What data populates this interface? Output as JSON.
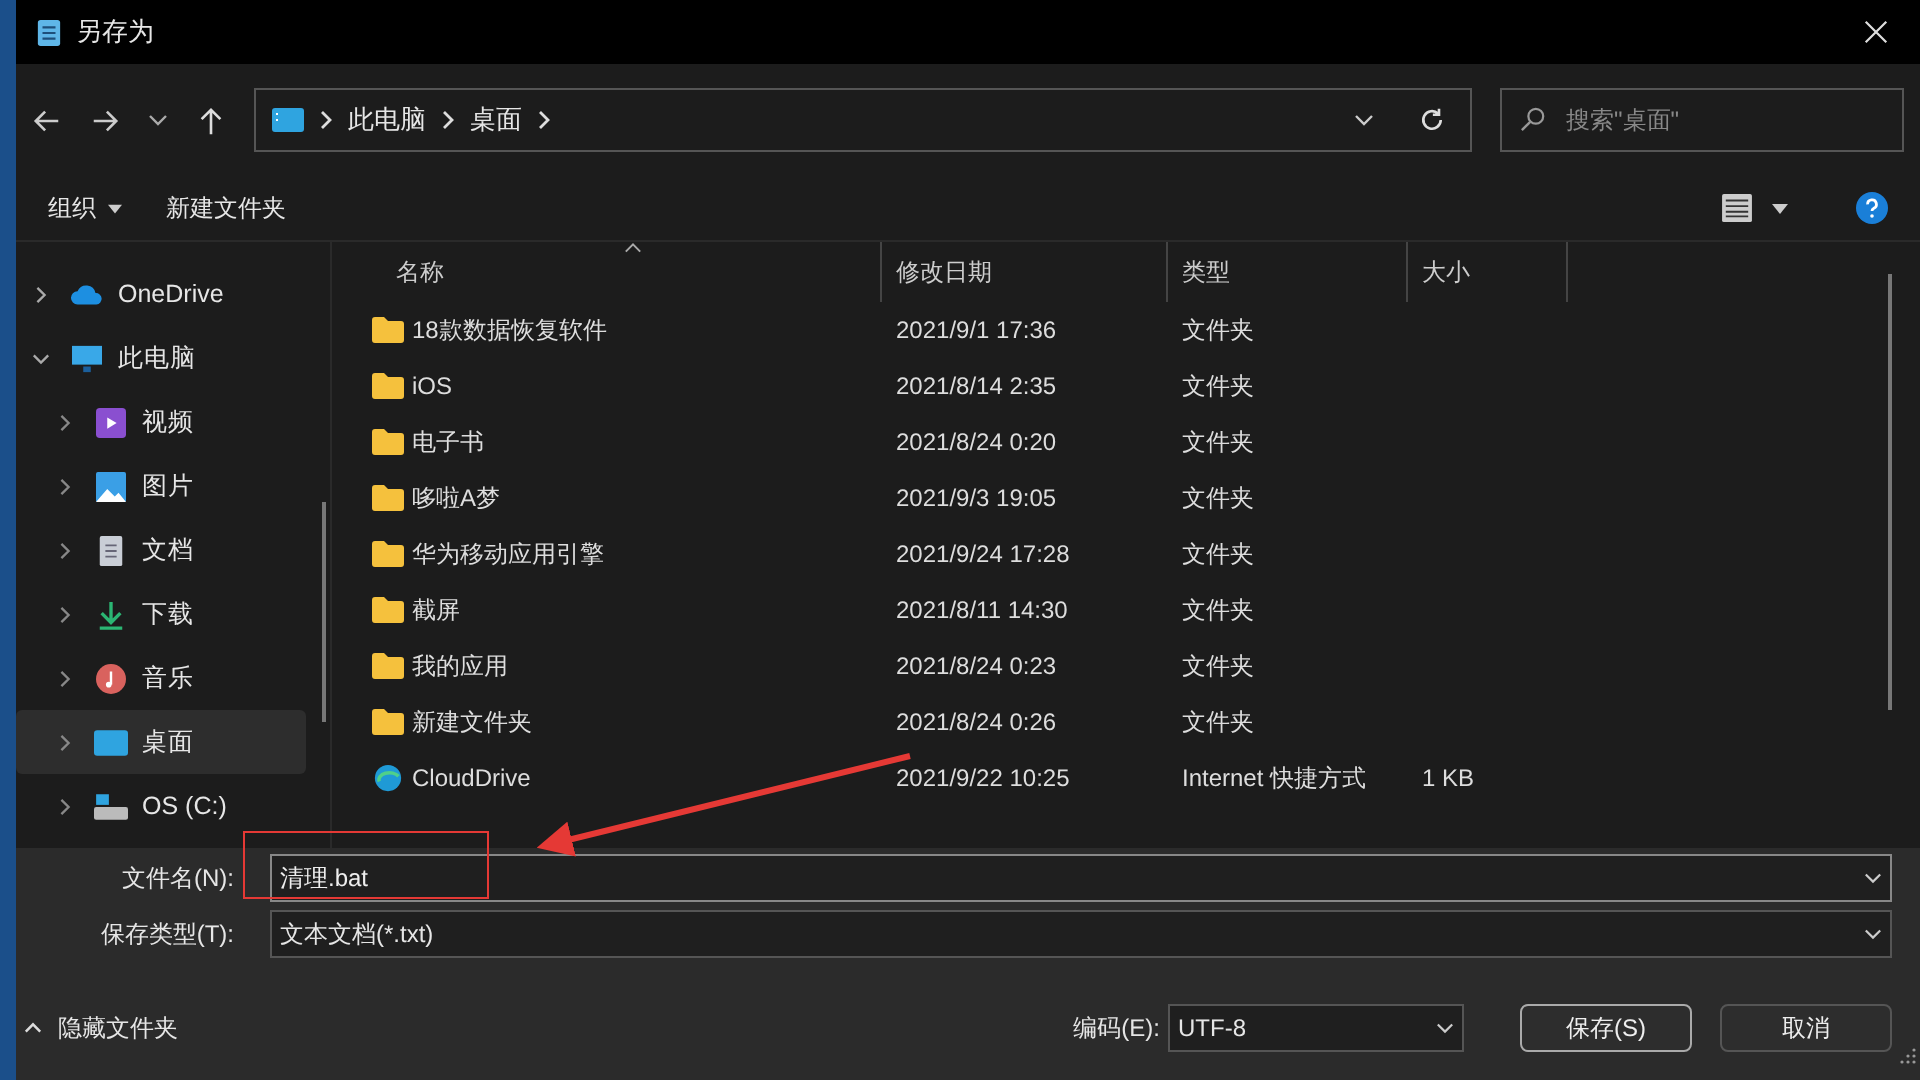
{
  "window": {
    "title": "另存为"
  },
  "nav": {
    "breadcrumb": [
      "此电脑",
      "桌面"
    ],
    "search": {
      "placeholder": "搜索\"桌面\""
    }
  },
  "toolbar": {
    "organize": "组织",
    "new_folder": "新建文件夹"
  },
  "sidebar": {
    "items": [
      {
        "label": "OneDrive",
        "expanded": false,
        "selected": false
      },
      {
        "label": "此电脑",
        "expanded": true,
        "selected": false,
        "children": [
          {
            "label": "视频",
            "expanded": false,
            "selected": false
          },
          {
            "label": "图片",
            "expanded": false,
            "selected": false
          },
          {
            "label": "文档",
            "expanded": false,
            "selected": false
          },
          {
            "label": "下载",
            "expanded": false,
            "selected": false
          },
          {
            "label": "音乐",
            "expanded": false,
            "selected": false
          },
          {
            "label": "桌面",
            "expanded": false,
            "selected": true
          },
          {
            "label": "OS (C:)",
            "expanded": false,
            "selected": false
          }
        ]
      }
    ]
  },
  "table": {
    "columns": [
      "名称",
      "修改日期",
      "类型",
      "大小"
    ],
    "rows": [
      {
        "kind": "folder",
        "name": "18款数据恢复软件",
        "date": "2021/9/1 17:36",
        "type": "文件夹",
        "size": ""
      },
      {
        "kind": "folder",
        "name": "iOS",
        "date": "2021/8/14 2:35",
        "type": "文件夹",
        "size": ""
      },
      {
        "kind": "folder",
        "name": "电子书",
        "date": "2021/8/24 0:20",
        "type": "文件夹",
        "size": ""
      },
      {
        "kind": "folder",
        "name": "哆啦A梦",
        "date": "2021/9/3 19:05",
        "type": "文件夹",
        "size": ""
      },
      {
        "kind": "folder",
        "name": "华为移动应用引擎",
        "date": "2021/9/24 17:28",
        "type": "文件夹",
        "size": ""
      },
      {
        "kind": "folder",
        "name": "截屏",
        "date": "2021/8/11 14:30",
        "type": "文件夹",
        "size": ""
      },
      {
        "kind": "folder",
        "name": "我的应用",
        "date": "2021/8/24 0:23",
        "type": "文件夹",
        "size": ""
      },
      {
        "kind": "folder",
        "name": "新建文件夹",
        "date": "2021/8/24 0:26",
        "type": "文件夹",
        "size": ""
      },
      {
        "kind": "shortcut",
        "name": "CloudDrive",
        "date": "2021/9/22 10:25",
        "type": "Internet 快捷方式",
        "size": "1 KB"
      }
    ]
  },
  "form": {
    "filename_label": "文件名(N):",
    "filename": "清理.bat",
    "filetype_label": "保存类型(T):",
    "filetype": "文本文档(*.txt)",
    "hide_folders": "隐藏文件夹",
    "encoding_label": "编码(E):",
    "encoding": "UTF-8",
    "buttons": [
      "保存(S)",
      "取消"
    ]
  }
}
